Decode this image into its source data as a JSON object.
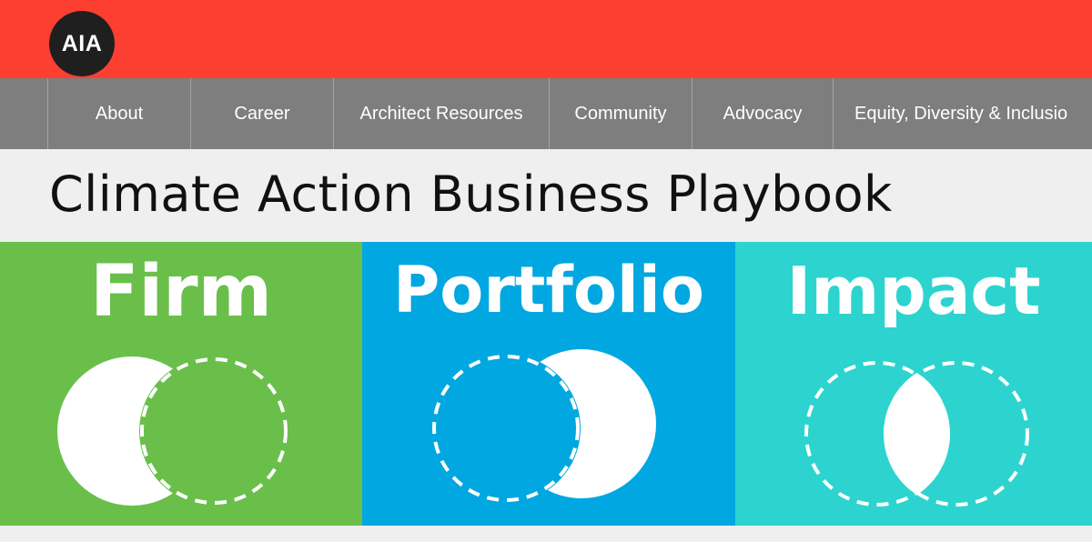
{
  "header": {
    "logo_text": "AIA",
    "bar_color": "#fd3f32"
  },
  "nav": {
    "items": [
      {
        "label": "About"
      },
      {
        "label": "Career"
      },
      {
        "label": "Architect Resources"
      },
      {
        "label": "Community"
      },
      {
        "label": "Advocacy"
      },
      {
        "label": "Equity, Diversity & Inclusio"
      }
    ]
  },
  "page": {
    "title": "Climate Action Business Playbook"
  },
  "hero": {
    "panels": [
      {
        "label": "Firm",
        "color": "#6abf4b",
        "icon": "crescent-left-venn-icon"
      },
      {
        "label": "Portfolio",
        "color": "#00a7e1",
        "icon": "crescent-right-venn-icon"
      },
      {
        "label": "Impact",
        "color": "#2dd4cf",
        "icon": "lens-intersection-venn-icon"
      }
    ]
  }
}
